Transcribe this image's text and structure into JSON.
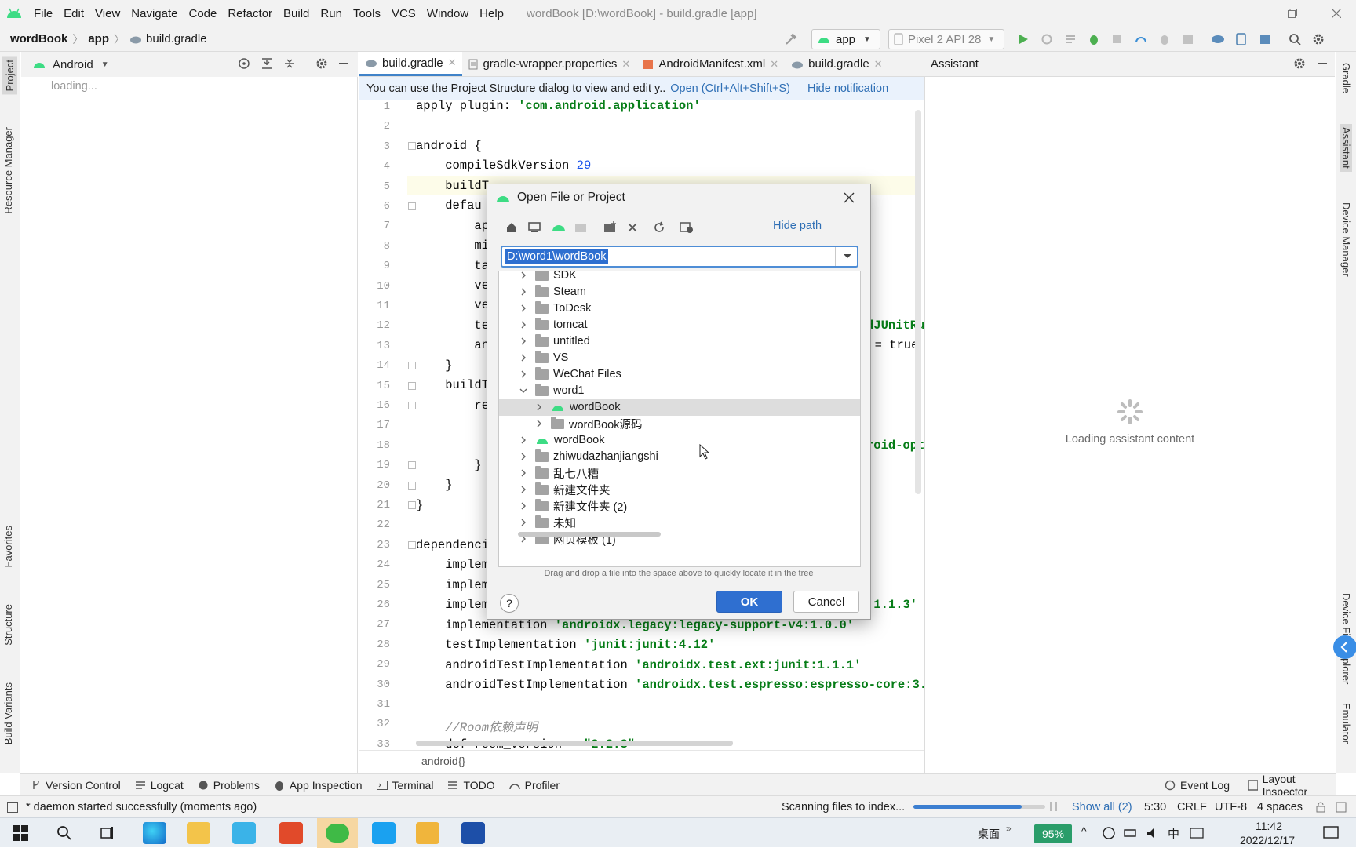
{
  "titlebar": {
    "menus": [
      "File",
      "Edit",
      "View",
      "Navigate",
      "Code",
      "Refactor",
      "Build",
      "Run",
      "Tools",
      "VCS",
      "Window",
      "Help"
    ],
    "title": "wordBook [D:\\wordBook] - build.gradle [app]"
  },
  "navbar": {
    "crumbs": [
      "wordBook",
      "app",
      "build.gradle"
    ],
    "run_config": "app",
    "device": "Pixel 2 API 28"
  },
  "left_stripe": {
    "project": "Project",
    "resource_manager": "Resource Manager",
    "favorites": "Favorites",
    "structure": "Structure",
    "build_variants": "Build Variants"
  },
  "right_stripe": {
    "gradle": "Gradle",
    "assistant": "Assistant",
    "device_manager": "Device Manager",
    "device_file_explorer": "Device File Explorer",
    "emulator": "Emulator"
  },
  "project_panel": {
    "view": "Android",
    "loading": "loading..."
  },
  "editor": {
    "tabs": [
      "build.gradle",
      "gradle-wrapper.properties",
      "AndroidManifest.xml",
      "build.gradle"
    ],
    "notification": {
      "text": "You can use the Project Structure dialog to view and edit y..",
      "open_link": "Open (Ctrl+Alt+Shift+S)",
      "hide_link": "Hide notification"
    },
    "line_numbers": [
      "1",
      "2",
      "3",
      "4",
      "5",
      "6",
      "7",
      "8",
      "9",
      "10",
      "11",
      "12",
      "13",
      "14",
      "15",
      "16",
      "17",
      "18",
      "19",
      "20",
      "21",
      "22",
      "23",
      "24",
      "25",
      "26",
      "27",
      "28",
      "29",
      "30",
      "31",
      "32",
      "33"
    ],
    "code": {
      "l1_a": "apply plugin: ",
      "l1_b": "'com.android.application'",
      "l3": "android {",
      "l4_a": "    compileSdkVersion ",
      "l4_b": "29",
      "l5": "    buildT",
      "l6": "    defau",
      "l7": "        ap",
      "l8": "        mi",
      "l9": "        ta",
      "l10": "        ve",
      "l11": "        ve",
      "l12": "        te",
      "l12_r": "dJUnitRu",
      "l13": "        an",
      "l13_r": "y = true",
      "l14": "    }",
      "l15": "    buildT",
      "l16": "        re",
      "l18_r": "roid-opt",
      "l19": "        }",
      "l20": "    }",
      "l21": "}",
      "l23": "dependenci",
      "l24": "    implem",
      "l25": "    implem",
      "l26": "    implem",
      "l26_r": ":1.1.3'",
      "l27_a": "    implementation ",
      "l27_b": "'androidx.legacy:legacy-support-v4:1.0.0'",
      "l28_a": "    testImplementation ",
      "l28_b": "'junit:junit:4.12'",
      "l29_a": "    androidTestImplementation ",
      "l29_b": "'androidx.test.ext:junit:1.1.1'",
      "l30_a": "    androidTestImplementation ",
      "l30_b": "'androidx.test.espresso:espresso-core:3.",
      "l32": "    //Room依赖声明",
      "l33_a": "    def room_version = ",
      "l33_b": "\"2.2.3\""
    },
    "breadcrumb": "android{}"
  },
  "assistant": {
    "title": "Assistant",
    "loading": "Loading assistant content"
  },
  "dialog": {
    "title": "Open File or Project",
    "hide_path": "Hide path",
    "path": "D:\\word1\\wordBook",
    "tree": [
      {
        "label": "SDK",
        "level": 0,
        "expanded": false
      },
      {
        "label": "Steam",
        "level": 0,
        "expanded": false
      },
      {
        "label": "ToDesk",
        "level": 0,
        "expanded": false
      },
      {
        "label": "tomcat",
        "level": 0,
        "expanded": false
      },
      {
        "label": "untitled",
        "level": 0,
        "expanded": false
      },
      {
        "label": "VS",
        "level": 0,
        "expanded": false
      },
      {
        "label": "WeChat Files",
        "level": 0,
        "expanded": false
      },
      {
        "label": "word1",
        "level": 0,
        "expanded": true
      },
      {
        "label": "wordBook",
        "level": 1,
        "expanded": false,
        "android": true,
        "selected": true
      },
      {
        "label": "wordBook源码",
        "level": 1,
        "expanded": false
      },
      {
        "label": "wordBook",
        "level": 0,
        "expanded": false,
        "android": true
      },
      {
        "label": "zhiwudazhanjiangshi",
        "level": 0,
        "expanded": false
      },
      {
        "label": "乱七八糟",
        "level": 0,
        "expanded": false
      },
      {
        "label": "新建文件夹",
        "level": 0,
        "expanded": false
      },
      {
        "label": "新建文件夹 (2)",
        "level": 0,
        "expanded": false
      },
      {
        "label": "未知",
        "level": 0,
        "expanded": false
      },
      {
        "label": "网页模板 (1)",
        "level": 0,
        "expanded": false
      }
    ],
    "hint": "Drag and drop a file into the space above to quickly locate it in the tree",
    "help": "?",
    "ok": "OK",
    "cancel": "Cancel"
  },
  "bottom_tools": [
    "Version Control",
    "Logcat",
    "Problems",
    "App Inspection",
    "Terminal",
    "TODO",
    "Profiler"
  ],
  "bottom_right_tools": [
    "Event Log",
    "Layout Inspector"
  ],
  "statusbar": {
    "message": "* daemon started successfully (moments ago)",
    "indexing": "Scanning files to index...",
    "indexing_progress": 0.82,
    "show_all": "Show all (2)",
    "position": "5:30",
    "line_sep": "CRLF",
    "encoding": "UTF-8",
    "indent": "4 spaces"
  },
  "taskbar": {
    "desktop": "桌面",
    "battery": "95%",
    "ime": "中",
    "time": "11:42",
    "date": "2022/12/17"
  },
  "colors": {
    "accent": "#4083c9",
    "android_green": "#3ddc84",
    "ok_button": "#2f6fd0",
    "string_green": "#067d17"
  }
}
